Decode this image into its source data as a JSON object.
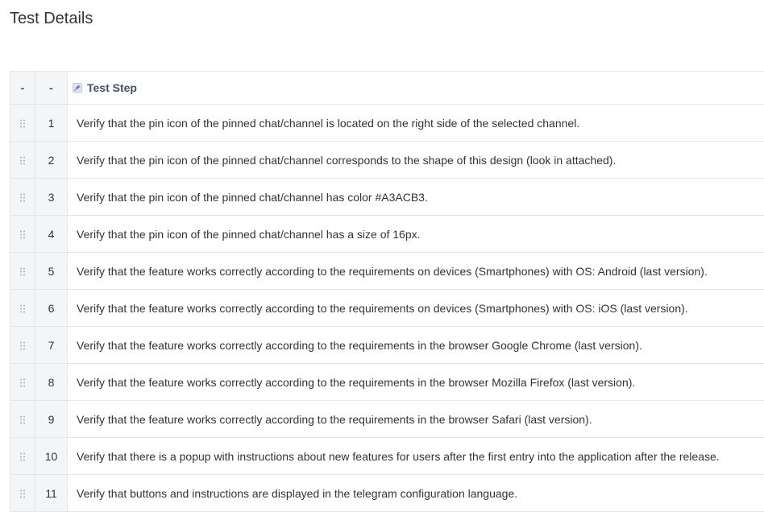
{
  "page": {
    "title": "Test Details"
  },
  "table": {
    "header": {
      "handle_col": "-",
      "num_col": "-",
      "step_col": "Test Step",
      "step_icon": "pin-icon"
    },
    "rows": [
      {
        "num": "1",
        "step": "Verify that the pin icon of the pinned chat/channel is located on the right side of the selected channel."
      },
      {
        "num": "2",
        "step": "Verify that the pin icon of the pinned chat/channel corresponds to the shape of this design (look in attached)."
      },
      {
        "num": "3",
        "step": "Verify that the pin icon of the pinned chat/channel has color #A3ACB3."
      },
      {
        "num": "4",
        "step": "Verify that the pin icon of the pinned chat/channel has a size of 16px."
      },
      {
        "num": "5",
        "step": "Verify that the feature works correctly according to the requirements on devices (Smartphones) with OS: Android (last version)."
      },
      {
        "num": "6",
        "step": "Verify that the feature works correctly according to the requirements on devices (Smartphones) with OS: iOS (last version)."
      },
      {
        "num": "7",
        "step": "Verify that the feature works correctly according to the requirements in the browser Google Chrome (last version)."
      },
      {
        "num": "8",
        "step": "Verify that the feature works correctly according to the requirements in the browser Mozilla Firefox (last version)."
      },
      {
        "num": "9",
        "step": "Verify that the feature works correctly according to the requirements in the browser Safari (last version)."
      },
      {
        "num": "10",
        "step": "Verify that there is a popup with instructions about new features for users after the first entry into the application after the release."
      },
      {
        "num": "11",
        "step": "Verify that buttons and instructions are displayed in the telegram configuration language."
      }
    ]
  },
  "icons": {
    "drag_handle": "drag-handle-icon",
    "pin": "pin-icon"
  },
  "colors": {
    "header_bg": "#f4f5f7",
    "border": "#e4e6ea",
    "text": "#333333",
    "header_text": "#42526e"
  }
}
